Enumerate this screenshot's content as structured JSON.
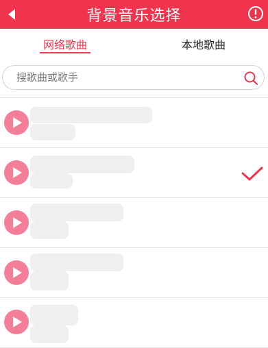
{
  "header": {
    "title": "背景音乐选择",
    "back_icon": "back-arrow-icon",
    "info_icon": "info-circle-icon",
    "color": "#f0344e"
  },
  "tabs": [
    {
      "label": "网络歌曲",
      "active": true
    },
    {
      "label": "本地歌曲",
      "active": false
    }
  ],
  "search": {
    "placeholder": "搜歌曲或歌手",
    "value": "",
    "icon": "search-icon"
  },
  "songs": [
    {
      "selected": false
    },
    {
      "selected": true
    },
    {
      "selected": false
    },
    {
      "selected": false
    },
    {
      "selected": false
    }
  ],
  "colors": {
    "accent": "#f0344e",
    "play": "#f27e97"
  }
}
